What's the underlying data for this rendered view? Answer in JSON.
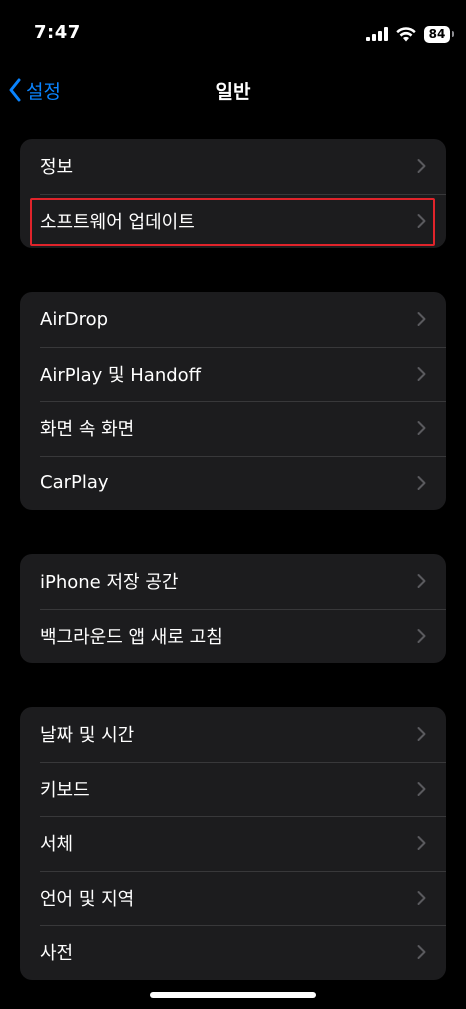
{
  "status_bar": {
    "time": "7:47",
    "battery": "84",
    "icons": [
      "cellular-signal-icon",
      "wifi-icon",
      "battery-icon"
    ]
  },
  "nav": {
    "back_label": "설정",
    "title": "일반"
  },
  "colors": {
    "background": "#000000",
    "group_background": "#1c1c1e",
    "accent": "#0a84ff",
    "highlight_border": "#e0242b",
    "chevron": "#5a5a5e"
  },
  "groups": [
    {
      "items": [
        {
          "label": "정보"
        },
        {
          "label": "소프트웨어 업데이트",
          "highlighted": true
        }
      ]
    },
    {
      "items": [
        {
          "label": "AirDrop"
        },
        {
          "label": "AirPlay 및 Handoff"
        },
        {
          "label": "화면 속 화면"
        },
        {
          "label": "CarPlay"
        }
      ]
    },
    {
      "items": [
        {
          "label": "iPhone 저장 공간"
        },
        {
          "label": "백그라운드 앱 새로 고침"
        }
      ]
    },
    {
      "items": [
        {
          "label": "날짜 및 시간"
        },
        {
          "label": "키보드"
        },
        {
          "label": "서체"
        },
        {
          "label": "언어 및 지역"
        },
        {
          "label": "사전"
        }
      ]
    }
  ]
}
